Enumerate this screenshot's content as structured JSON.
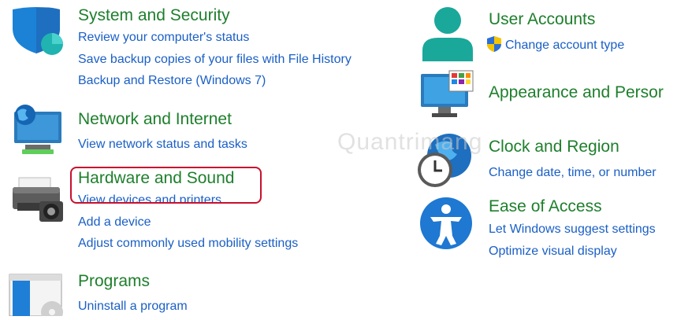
{
  "system_security": {
    "title": "System and Security",
    "links": [
      "Review your computer's status",
      "Save backup copies of your files with File History",
      "Backup and Restore (Windows 7)"
    ]
  },
  "network": {
    "title": "Network and Internet",
    "links": [
      "View network status and tasks"
    ]
  },
  "hardware": {
    "title": "Hardware and Sound",
    "links": [
      "View devices and printers",
      "Add a device",
      "Adjust commonly used mobility settings"
    ]
  },
  "programs": {
    "title": "Programs",
    "links": [
      "Uninstall a program"
    ]
  },
  "user_accounts": {
    "title": "User Accounts",
    "links": [
      "Change account type"
    ]
  },
  "appearance": {
    "title": "Appearance and Persor"
  },
  "clock": {
    "title": "Clock and Region",
    "links": [
      "Change date, time, or number"
    ]
  },
  "ease": {
    "title": "Ease of Access",
    "links": [
      "Let Windows suggest settings",
      "Optimize visual display"
    ]
  },
  "watermark": "Quantrimang",
  "colors": {
    "title_green": "#1e7f2c",
    "link_blue": "#1a5fc6",
    "highlight_red": "#c8102e"
  }
}
